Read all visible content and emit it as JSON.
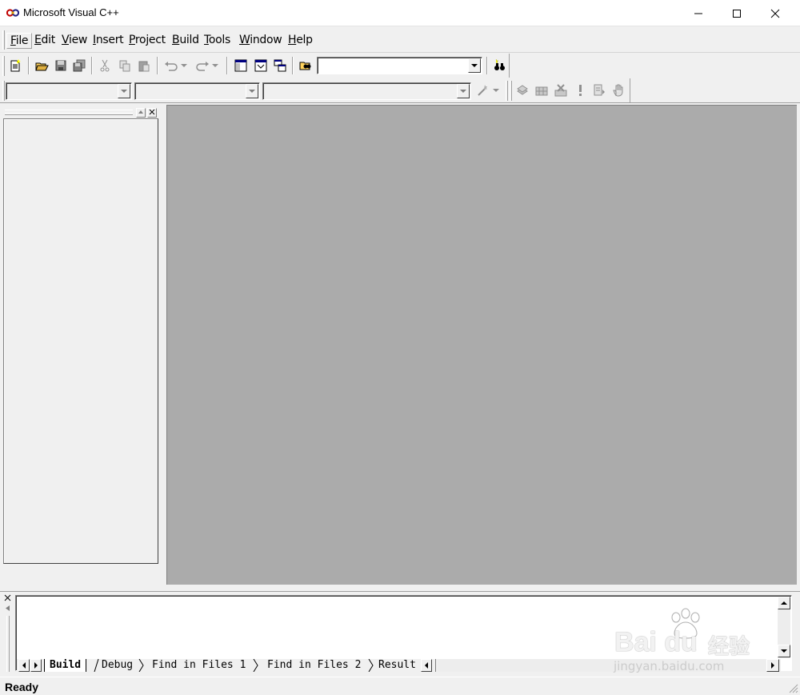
{
  "window": {
    "title": "Microsoft Visual C++"
  },
  "menu": {
    "items": [
      {
        "label": "File",
        "key": "F",
        "rest": "ile"
      },
      {
        "label": "Edit",
        "key": "E",
        "rest": "dit"
      },
      {
        "label": "View",
        "key": "V",
        "rest": "iew"
      },
      {
        "label": "Insert",
        "key": "I",
        "rest": "nsert"
      },
      {
        "label": "Project",
        "key": "P",
        "rest": "roject"
      },
      {
        "label": "Build",
        "key": "B",
        "rest": "uild"
      },
      {
        "label": "Tools",
        "key": "T",
        "rest": "ools"
      },
      {
        "label": "Window",
        "key": "W",
        "rest": "indow"
      },
      {
        "label": "Help",
        "key": "H",
        "rest": "elp"
      }
    ]
  },
  "toolbar": {
    "find_combo_value": "",
    "icons": [
      "new-text-file-icon",
      "open-folder-icon",
      "save-icon",
      "save-all-icon",
      "cut-icon",
      "copy-icon",
      "paste-icon",
      "undo-icon",
      "redo-icon",
      "workspace-icon",
      "output-icon",
      "window-list-icon",
      "find-in-files-icon",
      "find-icon"
    ]
  },
  "wizardbar": {
    "class_combo": "",
    "filter_combo": "",
    "members_combo": "",
    "icons": [
      "wizard-action-icon",
      "compile-icon",
      "build-icon",
      "stop-build-icon",
      "execute-icon",
      "go-icon",
      "breakpoint-icon"
    ]
  },
  "output": {
    "tabs": [
      "Build",
      "Debug",
      "Find in Files 1",
      "Find in Files 2",
      "Result"
    ],
    "active_tab": "Build"
  },
  "status": {
    "text": "Ready"
  },
  "watermark": {
    "main": "Bai du",
    "cn": "经验",
    "sub": "jingyan.baidu.com"
  },
  "colors": {
    "mdi_background": "#ababab",
    "chrome": "#f0f0f0"
  }
}
